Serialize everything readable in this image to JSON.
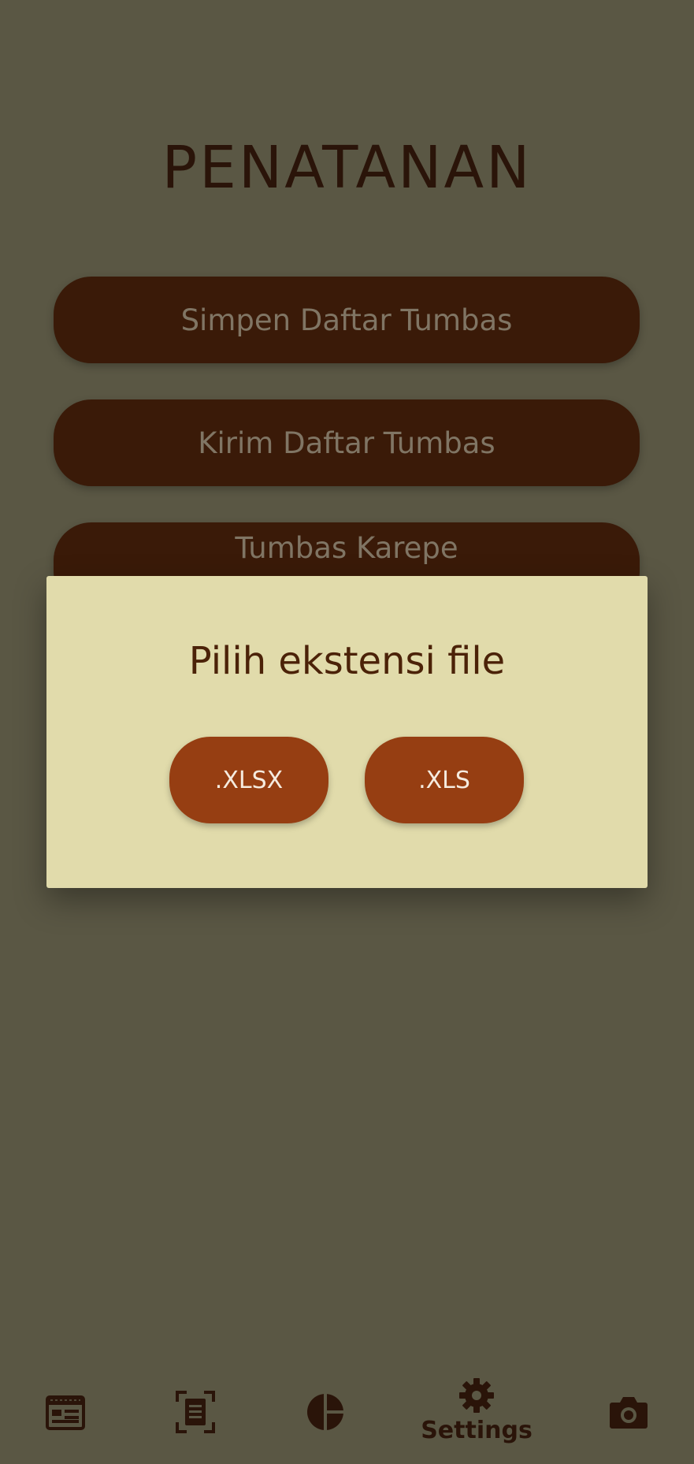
{
  "page": {
    "title": "PENATANAN"
  },
  "menu": {
    "save_list": "Simpen Daftar Tumbas",
    "send_list": "Kirim Daftar Tumbas",
    "buy_custom": "Tumbas Karepe"
  },
  "dialog": {
    "title": "Pilih ekstensi file",
    "options": [
      ".XLSX",
      ".XLS"
    ]
  },
  "bottom_nav": {
    "items": [
      {
        "icon": "list-table-icon",
        "label": ""
      },
      {
        "icon": "document-scan-icon",
        "label": ""
      },
      {
        "icon": "pie-chart-icon",
        "label": ""
      },
      {
        "icon": "gear-icon",
        "label": "Settings"
      },
      {
        "icon": "camera-icon",
        "label": ""
      }
    ],
    "active": "Settings"
  },
  "colors": {
    "background": "#5a5744",
    "button": "#3a1a08",
    "dialog": "#e1dbab",
    "accent": "#963e12",
    "text_dark": "#2a1409"
  }
}
